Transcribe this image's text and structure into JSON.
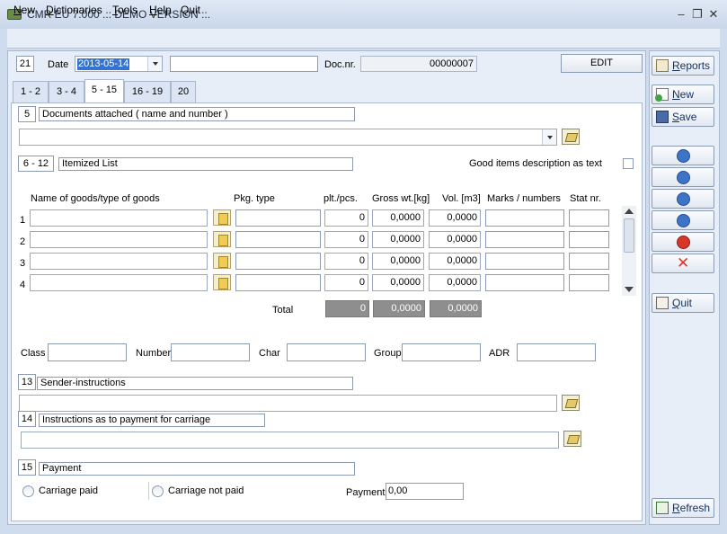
{
  "window": {
    "title": "CMR EU 7.000 .:: DEMO VERSION ::."
  },
  "menu": [
    {
      "first": "N",
      "rest": "ew"
    },
    {
      "first": "D",
      "rest": "ictionaries"
    },
    {
      "first": "T",
      "rest": "ools"
    },
    {
      "first": "H",
      "rest": "elp"
    },
    {
      "first": "",
      "rest": "Quit"
    }
  ],
  "header": {
    "box_number": "21",
    "date_label": "Date",
    "date_value": "2013-05-14",
    "extra_field": "",
    "docnr_label": "Doc.nr.",
    "docnr_value": "00000007",
    "edit_label": "EDIT"
  },
  "tabs": [
    "1 - 2",
    "3 - 4",
    "5 - 15",
    "16 - 19",
    "20"
  ],
  "active_tab": "5 - 15",
  "sections": {
    "s5": {
      "num": "5",
      "title": "Documents attached ( name and number )",
      "value": ""
    },
    "s6": {
      "num": "6 - 12",
      "title": "Itemized List",
      "checkbox_label": "Good items description as text"
    },
    "s13": {
      "num": "13",
      "title": "Sender-instructions",
      "value": ""
    },
    "s14": {
      "num": "14",
      "title": "Instructions as to payment for carriage",
      "value": ""
    },
    "s15": {
      "num": "15",
      "title": "Payment"
    }
  },
  "table": {
    "columns": {
      "name": "Name of goods/type of goods",
      "pkg": "Pkg. type",
      "pcs": "plt./pcs.",
      "gross": "Gross wt.[kg]",
      "vol": "Vol. [m3]",
      "marks": "Marks / numbers",
      "stat": "Stat nr."
    },
    "rows": [
      {
        "index": "1",
        "name": "",
        "pkg": "",
        "pcs": "0",
        "gross": "0,0000",
        "vol": "0,0000",
        "marks": "",
        "stat": ""
      },
      {
        "index": "2",
        "name": "",
        "pkg": "",
        "pcs": "0",
        "gross": "0,0000",
        "vol": "0,0000",
        "marks": "",
        "stat": ""
      },
      {
        "index": "3",
        "name": "",
        "pkg": "",
        "pcs": "0",
        "gross": "0,0000",
        "vol": "0,0000",
        "marks": "",
        "stat": ""
      },
      {
        "index": "4",
        "name": "",
        "pkg": "",
        "pcs": "0",
        "gross": "0,0000",
        "vol": "0,0000",
        "marks": "",
        "stat": ""
      }
    ],
    "total_label": "Total",
    "total": {
      "pcs": "0",
      "gross": "0,0000",
      "vol": "0,0000"
    }
  },
  "adr": {
    "class_label": "Class",
    "number_label": "Number",
    "char_label": "Char",
    "group_label": "Group",
    "adr_label": "ADR"
  },
  "payment": {
    "carriage_paid": "Carriage paid",
    "carriage_not_paid": "Carriage not paid",
    "payment_label": "Payment",
    "payment_value": "0,00"
  },
  "sidebar": {
    "reports": {
      "first": "R",
      "rest": "eports"
    },
    "new": {
      "first": "N",
      "rest": "ew"
    },
    "save": {
      "first": "S",
      "rest": "ave"
    },
    "quit": {
      "first": "Q",
      "rest": "uit"
    },
    "refresh": {
      "first": "R",
      "rest": "efresh"
    }
  }
}
